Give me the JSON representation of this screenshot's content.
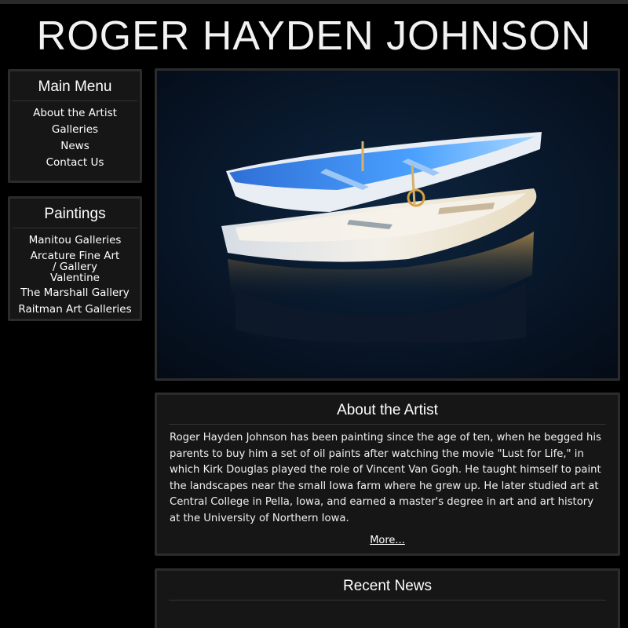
{
  "site": {
    "title": "ROGER HAYDEN JOHNSON"
  },
  "main_menu": {
    "heading": "Main Menu",
    "items": [
      "About the Artist",
      "Galleries",
      "News",
      "Contact Us"
    ]
  },
  "paintings": {
    "heading": "Paintings",
    "items": [
      "Manitou Galleries",
      "Arcature Fine Art / Gallery Valentine",
      "The Marshall Gallery",
      "Raitman Art Galleries"
    ]
  },
  "about": {
    "heading": "About the Artist",
    "body": "Roger Hayden Johnson has been painting since the age of ten, when he begged his parents to buy him a set of oil paints after watching the movie \"Lust for Life,\" in which Kirk Douglas played the role of Vincent Van Gogh. He taught himself to paint the landscapes near the small Iowa farm where he grew up. He later studied art at Central College in Pella, Iowa, and earned a master's degree in art and art history at the University of Northern Iowa.",
    "more_link": "More..."
  },
  "news": {
    "heading": "Recent News"
  },
  "colors": {
    "background": "#000000",
    "panel": "#161616",
    "panel_border": "#2c2c2c",
    "text": "#ffffff"
  }
}
